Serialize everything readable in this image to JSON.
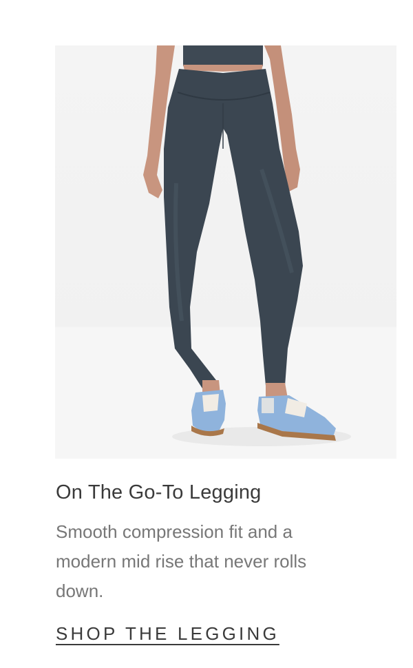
{
  "product": {
    "title": "On The Go-To Legging",
    "description": "Smooth compression fit and a modern mid rise that never rolls down.",
    "cta_label": "SHOP THE LEGGING"
  },
  "image": {
    "subject": "model-wearing-navy-legging-and-blue-sneakers"
  },
  "colors": {
    "legging": "#3b4651",
    "skin": "#c8957f",
    "sneaker": "#8fb3dc",
    "sneaker_sole": "#a9774a",
    "background": "#f2f2f2",
    "title_text": "#3a3a3a",
    "body_text": "#777777"
  }
}
